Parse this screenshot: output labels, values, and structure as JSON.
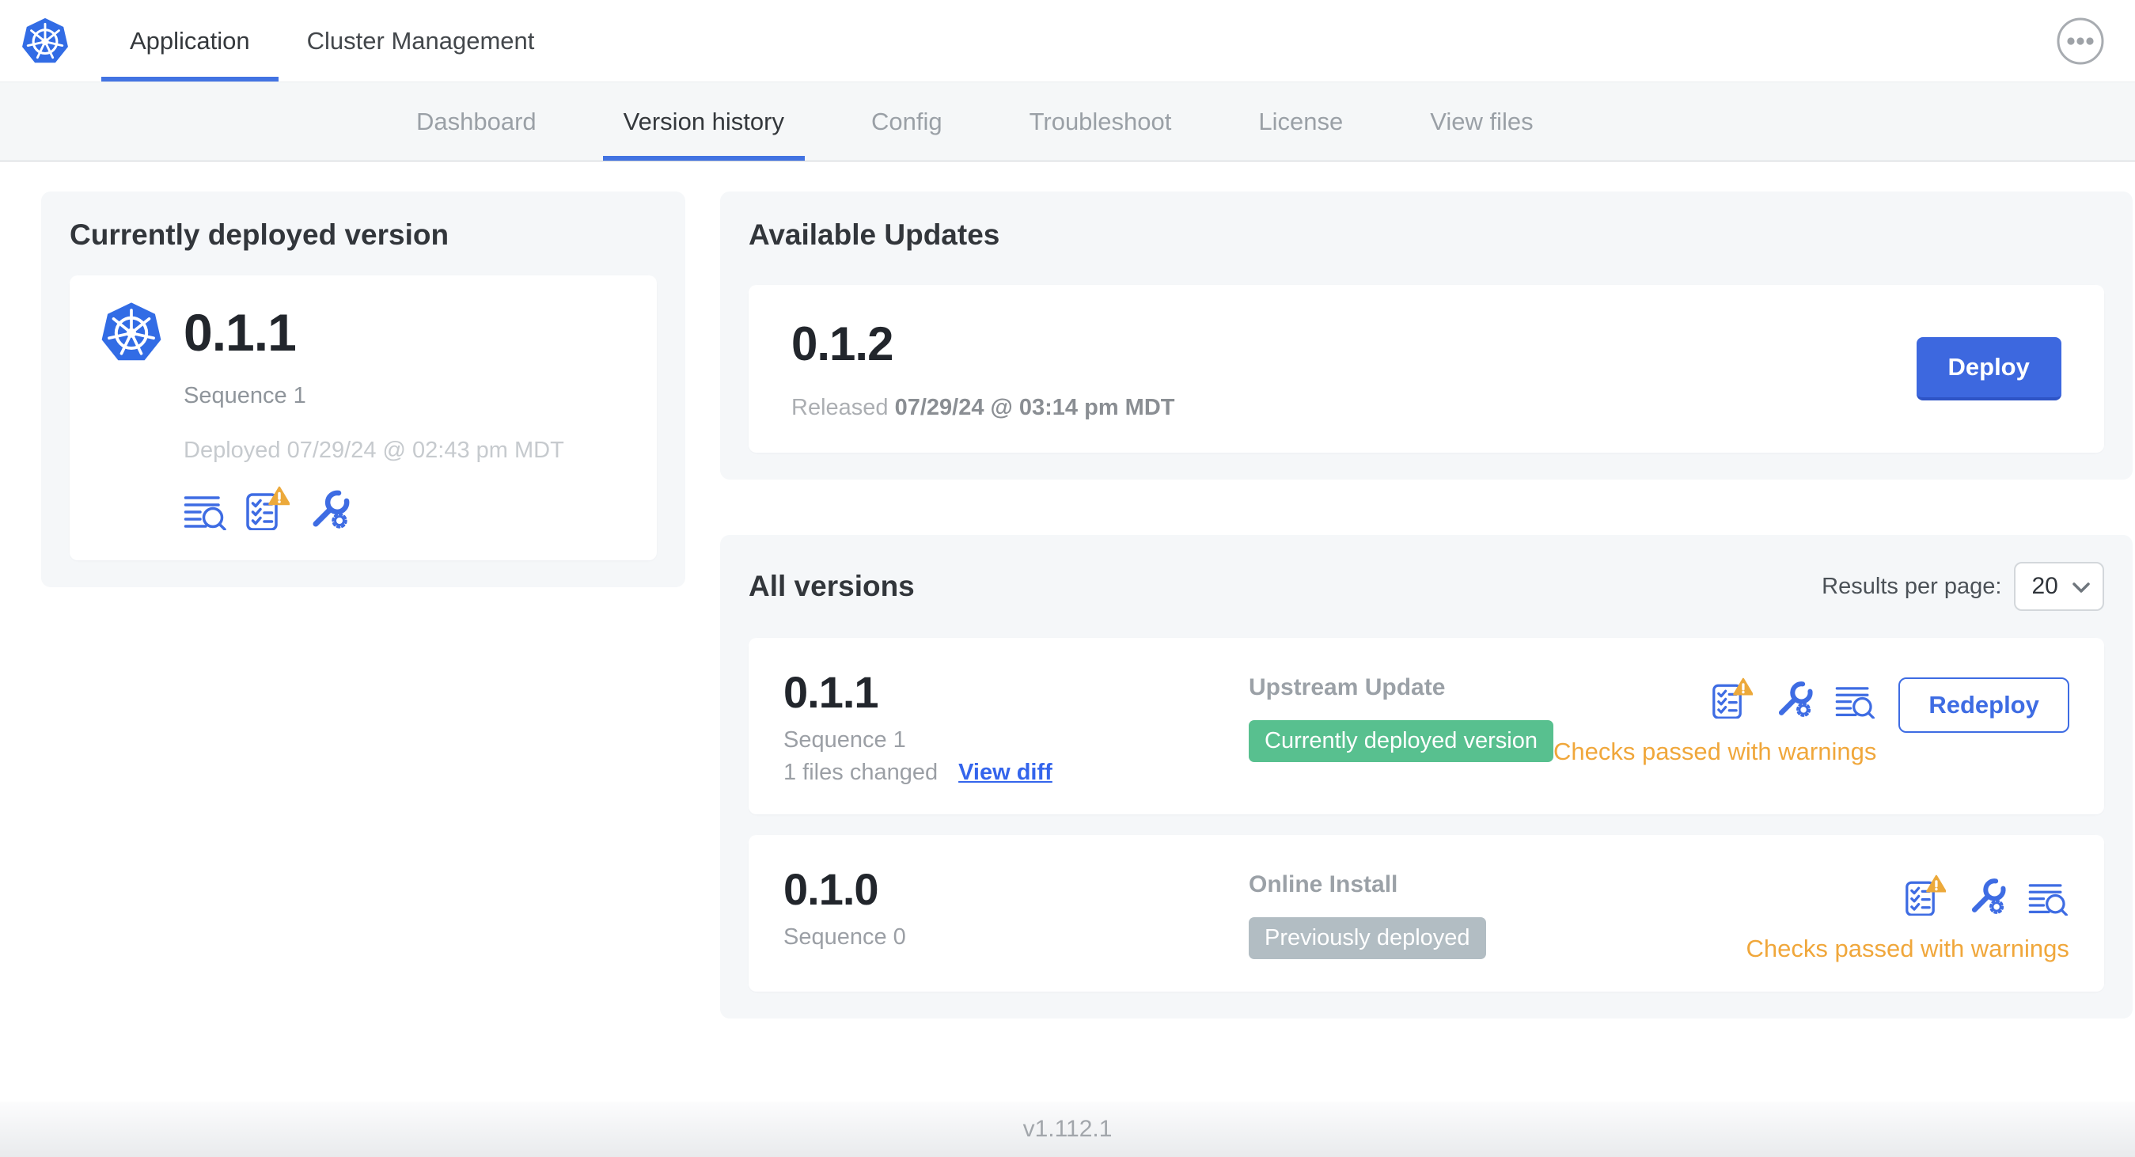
{
  "colors": {
    "primary_blue": "#3E6CE3",
    "kubernetes_blue": "#326CE5",
    "deploy_button_blue": "#3D68DF",
    "active_tab_underline": "#4273E2",
    "currently_deployed_badge_green": "#58C08F",
    "previously_deployed_badge_gray": "#B2BDC3",
    "warning_amber": "#EFA93C"
  },
  "icons": {
    "logo": "kubernetes-logo",
    "header_more": "ellipsis-circle-icon",
    "deploy_logs": "deploy-logs-icon",
    "preflight": "preflight-checks-warning-icon",
    "edit_config": "edit-config-icon",
    "select_chevron": "chevron-down-icon"
  },
  "header": {
    "app_tabs": [
      {
        "label": "Application"
      },
      {
        "label": "Cluster Management"
      }
    ]
  },
  "subnav": {
    "tabs": [
      {
        "label": "Dashboard"
      },
      {
        "label": "Version history"
      },
      {
        "label": "Config"
      },
      {
        "label": "Troubleshoot"
      },
      {
        "label": "License"
      },
      {
        "label": "View files"
      }
    ]
  },
  "current_version": {
    "heading": "Currently deployed version",
    "version": "0.1.1",
    "sequence": "Sequence 1",
    "deployed": "Deployed 07/29/24 @ 02:43 pm MDT"
  },
  "available_updates": {
    "heading": "Available Updates",
    "version": "0.1.2",
    "released_label": "Released",
    "released_date": "07/29/24 @ 03:14 pm MDT",
    "deploy_button": "Deploy"
  },
  "all_versions": {
    "heading": "All versions",
    "results_per_page_label": "Results per page:",
    "results_per_page": "20",
    "rows": [
      {
        "version": "0.1.1",
        "sequence": "Sequence 1",
        "files_changed": "1 files changed",
        "view_diff": "View diff",
        "source": "Upstream Update",
        "badge": "Currently deployed version",
        "status": "Checks passed with warnings",
        "action": "Redeploy"
      },
      {
        "version": "0.1.0",
        "sequence": "Sequence 0",
        "source": "Online Install",
        "badge": "Previously deployed",
        "status": "Checks passed with warnings"
      }
    ]
  },
  "footer": {
    "version": "v1.112.1"
  }
}
